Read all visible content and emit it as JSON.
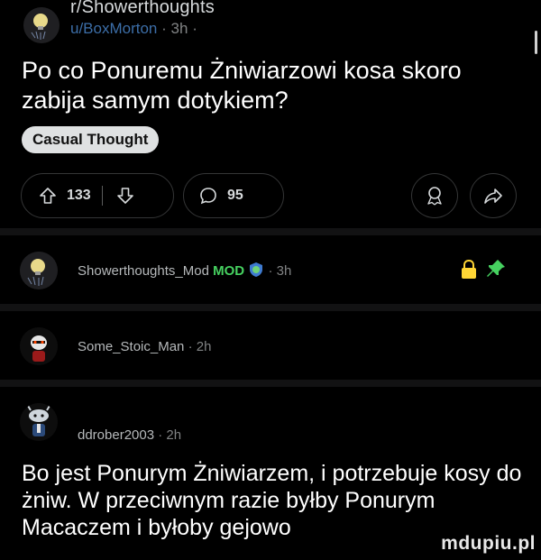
{
  "post": {
    "subreddit": "r/Showerthoughts",
    "author": "u/BoxMorton",
    "age": "3h",
    "meta_sep": "·",
    "title": "Po co Ponuremu Żniwiarzowi kosa skoro zabija samym dotykiem?",
    "flair": "Casual Thought",
    "upvotes": "133",
    "comments": "95"
  },
  "comments": [
    {
      "author": "Showerthoughts_Mod",
      "tag": "MOD",
      "age": "3h"
    },
    {
      "author": "Some_Stoic_Man",
      "age": "2h"
    },
    {
      "author": "ddrober2003",
      "age": "2h",
      "body": "Bo jest Ponurym Żniwiarzem, i potrzebuje kosy do żniw. W przeciwnym razie byłby Ponurym Macaczem i byłoby gejowo"
    }
  ],
  "watermark": "mdupiu.pl",
  "colors": {
    "background": "#000000",
    "link": "#3c6ea8",
    "mod": "#46d160",
    "muted": "#818384"
  },
  "icons": [
    "upvote-icon",
    "downvote-icon",
    "comment-icon",
    "award-icon",
    "share-icon",
    "lock-icon",
    "pin-icon",
    "shield-badge-icon"
  ]
}
